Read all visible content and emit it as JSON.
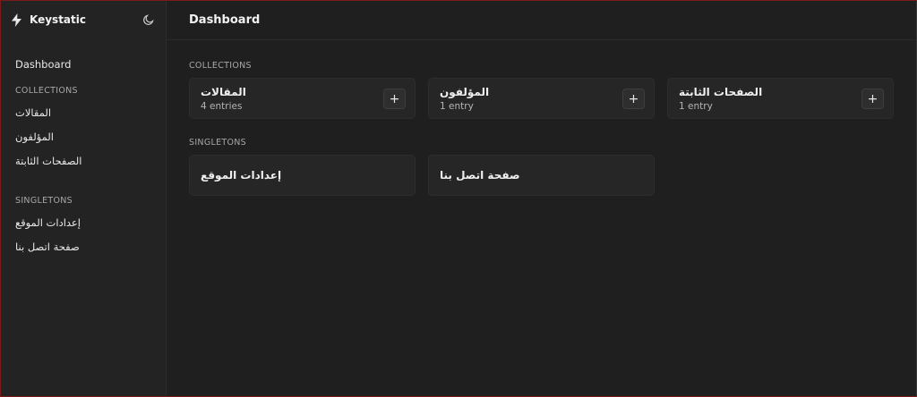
{
  "app": {
    "name": "Keystatic",
    "logo_icon": "keystatic-logo-icon",
    "theme_icon": "moon-icon"
  },
  "sidebar": {
    "dashboard_label": "Dashboard",
    "collections_heading": "COLLECTIONS",
    "collections": [
      {
        "label": "المقالات"
      },
      {
        "label": "المؤلفون"
      },
      {
        "label": "الصفحات الثابتة"
      }
    ],
    "singletons_heading": "SINGLETONS",
    "singletons": [
      {
        "label": "إعدادات الموقع"
      },
      {
        "label": "صفحة اتصل بنا"
      }
    ]
  },
  "header": {
    "title": "Dashboard"
  },
  "main": {
    "collections_heading": "COLLECTIONS",
    "collections": [
      {
        "title": "المقالات",
        "count": "4 entries",
        "add_icon": "plus-icon",
        "add_label": "+"
      },
      {
        "title": "المؤلفون",
        "count": "1 entry",
        "add_icon": "plus-icon",
        "add_label": "+"
      },
      {
        "title": "الصفحات الثابتة",
        "count": "1 entry",
        "add_icon": "plus-icon",
        "add_label": "+"
      }
    ],
    "singletons_heading": "SINGLETONS",
    "singletons": [
      {
        "title": "إعدادات الموقع"
      },
      {
        "title": "صفحة اتصل بنا"
      }
    ]
  },
  "colors": {
    "background": "#1e1e1e",
    "sidebar": "#232323",
    "card": "#262626",
    "frame_border": "#7a1b1b"
  }
}
